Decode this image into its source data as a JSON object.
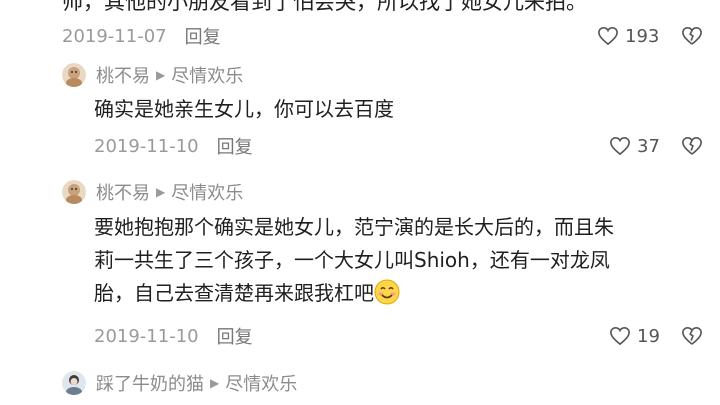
{
  "top_comment": {
    "text_cut": "帅，其他的小朋友看到了怕会哭，所以找了她女儿来拍。",
    "date": "2019-11-07",
    "reply_label": "回复",
    "likes": "193"
  },
  "comments": [
    {
      "user": "桃不易",
      "reply_to": "尽情欢乐",
      "line1": "确实是她亲生女儿，你可以去百度",
      "date": "2019-11-10",
      "reply_label": "回复",
      "likes": "37"
    },
    {
      "user": "桃不易",
      "reply_to": "尽情欢乐",
      "line1": "要她抱抱那个确实是她女儿，范宁演的是长大后的，而且朱",
      "line2": "莉一共生了三个孩子，一个大女儿叫Shioh，还有一对龙凤",
      "line3": "胎，自己去查清楚再来跟我杠吧",
      "date": "2019-11-10",
      "reply_label": "回复",
      "likes": "19"
    },
    {
      "user": "踩了牛奶的猫",
      "reply_to": "尽情欢乐"
    }
  ],
  "icons": {
    "like": "heart-outline-icon",
    "dislike": "broken-heart-icon",
    "arrow": "right-triangle-icon",
    "emoji": "smiling-face-emoji"
  }
}
